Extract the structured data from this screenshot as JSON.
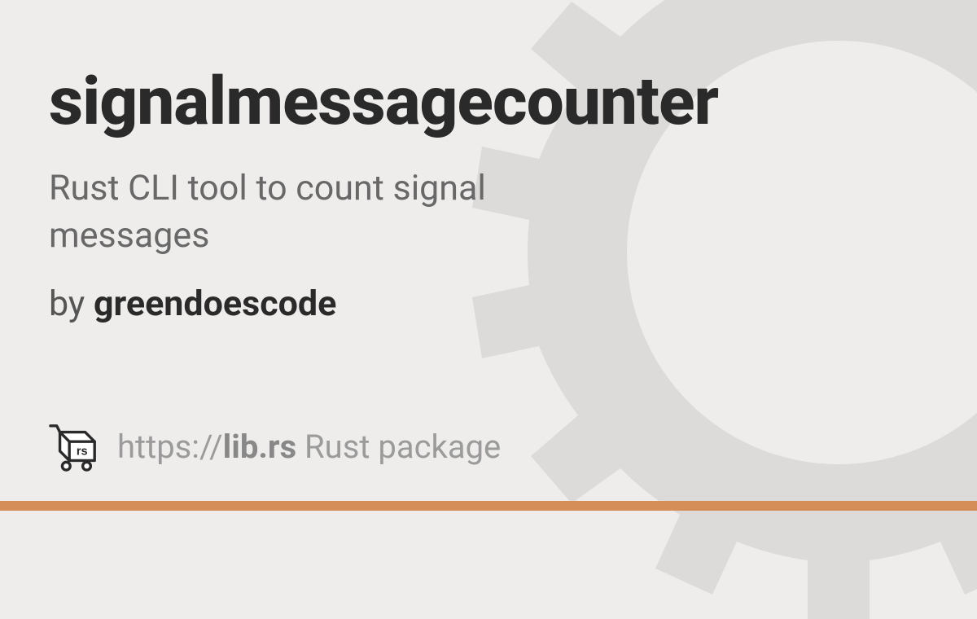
{
  "package": {
    "name": "signalmessagecounter",
    "description": "Rust CLI tool to count signal messages",
    "by_label": "by",
    "author": "greendoescode"
  },
  "footer": {
    "url_prefix": "https://",
    "url_domain": "lib.rs",
    "url_suffix": " Rust package"
  },
  "colors": {
    "background": "#eeedec",
    "gear": "#dcdbda",
    "text_dark": "#2a2a2a",
    "text_medium": "#686868",
    "text_light": "#9b9b9b",
    "accent_bar": "#d68e59"
  }
}
